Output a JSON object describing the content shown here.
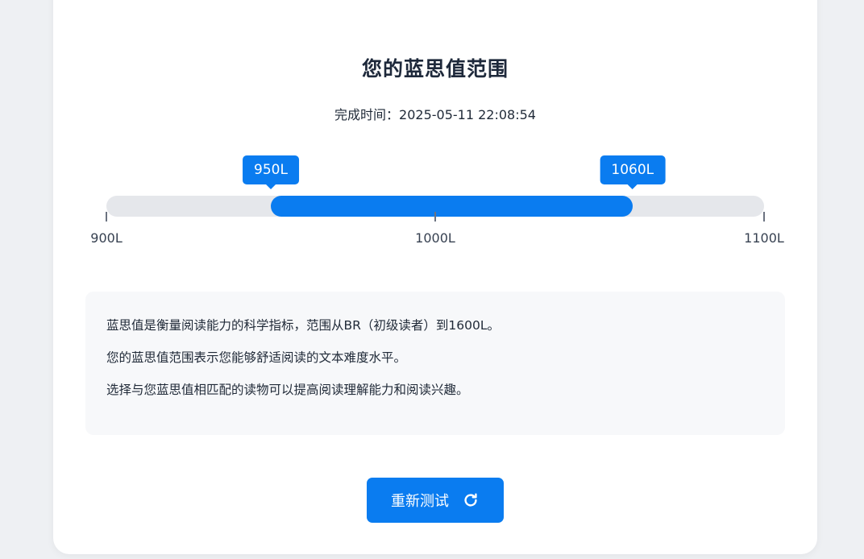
{
  "page": {
    "title": "您的蓝思值范围",
    "completion_label": "完成时间：",
    "completion_time": "2025-05-11 22:08:54"
  },
  "range": {
    "scale_min": 900,
    "scale_max": 1100,
    "low_label": "950L",
    "high_label": "1060L",
    "low_value": 950,
    "high_value": 1060,
    "ticks": [
      "900L",
      "1000L",
      "1100L"
    ]
  },
  "info": {
    "lines": [
      "蓝思值是衡量阅读能力的科学指标，范围从BR（初级读者）到1600L。",
      "您的蓝思值范围表示您能够舒适阅读的文本难度水平。",
      "选择与您蓝思值相匹配的读物可以提高阅读理解能力和阅读兴趣。"
    ]
  },
  "actions": {
    "retest_label": "重新测试",
    "retest_icon": "refresh-icon"
  },
  "colors": {
    "accent": "#0a7cf0",
    "track": "#e5e7eb",
    "info_bg": "#f7f8fa"
  }
}
